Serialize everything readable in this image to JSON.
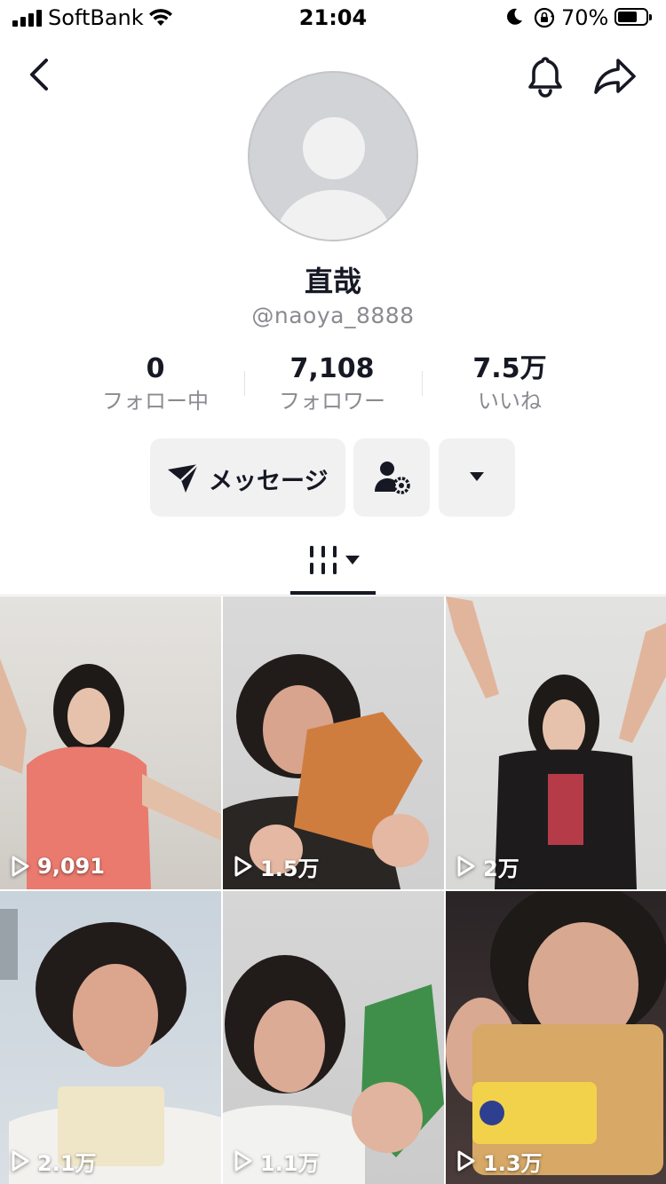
{
  "status_bar": {
    "carrier": "SoftBank",
    "time": "21:04",
    "battery_percent": "70%",
    "battery_level": 0.7
  },
  "header": {
    "back_icon": "chevron-left-icon",
    "bell_icon": "bell-icon",
    "share_icon": "share-arrow-icon"
  },
  "profile": {
    "display_name": "直哉",
    "username": "@naoya_8888"
  },
  "stats": [
    {
      "value": "0",
      "label": "フォロー中"
    },
    {
      "value": "7,108",
      "label": "フォロワー"
    },
    {
      "value": "7.5万",
      "label": "いいね"
    }
  ],
  "actions": {
    "message_label": "メッセージ",
    "message_icon": "paper-plane-icon",
    "user_settings_icon": "user-gear-icon",
    "more_icon": "caret-down-icon"
  },
  "tabs": {
    "active_icon": "grid-columns-icon",
    "dropdown_icon": "caret-down-icon"
  },
  "videos": [
    {
      "views": "9,091"
    },
    {
      "views": "1.5万"
    },
    {
      "views": "2万"
    },
    {
      "views": "2.1万"
    },
    {
      "views": "1.1万"
    },
    {
      "views": "1.3万"
    }
  ],
  "colors": {
    "text_primary": "#161823",
    "text_secondary": "#8a8b91",
    "button_bg": "#f1f1f2"
  }
}
